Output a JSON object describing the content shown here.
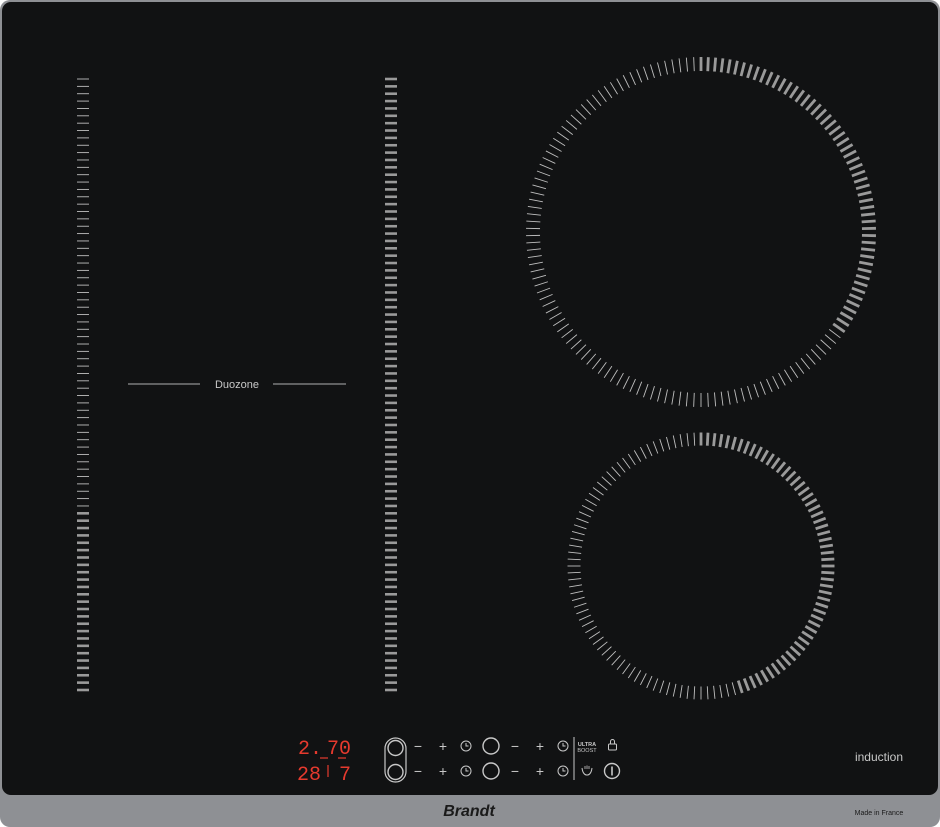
{
  "zones": {
    "duozone_label": "Duozone",
    "left_strip_active_fraction": 0.3,
    "right_strip_active_fraction": 1.0,
    "big_circle_active_fraction": 0.35,
    "small_circle_active_fraction": 0.45
  },
  "displays": {
    "top_left_digit": "2.",
    "top_right_digits": "70",
    "bottom_left_digits": "28",
    "bottom_right_digit": "7"
  },
  "controls": {
    "minus_symbol": "−",
    "plus_symbol": "+",
    "ultra_boost_line1": "ULTRA",
    "ultra_boost_line2": "BOOST"
  },
  "labels": {
    "induction": "induction",
    "brand": "Brandt",
    "made_in": "Made in France"
  },
  "colors": {
    "glass": "#111213",
    "frame": "#8e9094",
    "display_red": "#e63a2e",
    "tick": "#bfbfbf",
    "tick_active": "#9a9a9a",
    "print": "#c8c8c8"
  }
}
